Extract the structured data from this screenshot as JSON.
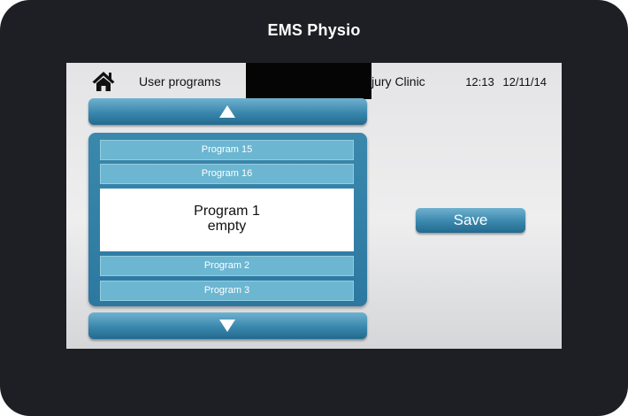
{
  "device": {
    "title": "EMS Physio",
    "bezel_color": "#1e1f24"
  },
  "header": {
    "title": "User programs",
    "clinic_name": "jury Clinic",
    "time": "12:13",
    "date": "12/11/14",
    "home_icon": "home-icon"
  },
  "nav": {
    "up_icon": "triangle-up-icon",
    "down_icon": "triangle-down-icon"
  },
  "programs": {
    "items": [
      {
        "label": "Program 15"
      },
      {
        "label": "Program 16"
      },
      {
        "label": "Program 2"
      },
      {
        "label": "Program 3"
      }
    ],
    "selected": {
      "label": "Program 1",
      "status": "empty"
    }
  },
  "actions": {
    "save_label": "Save"
  },
  "colors": {
    "accent": "#3a87ad",
    "list_item": "#6cb6d1",
    "selected_bg": "#ffffff"
  }
}
